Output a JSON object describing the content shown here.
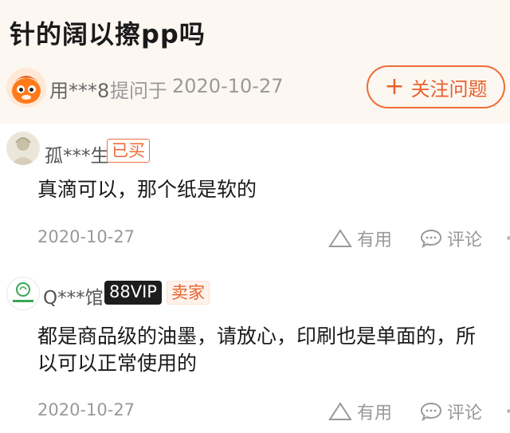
{
  "question": {
    "title": "针的阔以擦pp吗",
    "asker": "用***8",
    "ask_label": "提问于",
    "ask_date": "2020-10-27",
    "follow_label": "关注问题"
  },
  "answers": [
    {
      "user": "孤***生",
      "badges": [
        "已买"
      ],
      "lines": [
        "真滴可以，那个纸是软的"
      ],
      "date": "2020-10-27",
      "useful_label": "有用",
      "comment_label": "评论"
    },
    {
      "user": "Q***馆",
      "badges": [
        "88VIP",
        "卖家"
      ],
      "lines": [
        "都是商品级的油墨，请放心，印刷也是单面的，所",
        "以可以正常使用的"
      ],
      "date": "2020-10-27",
      "useful_label": "有用",
      "comment_label": "评论"
    }
  ],
  "colors": {
    "accent": "#e8612b",
    "header_bg": "#fdf7f2",
    "muted": "#999999"
  },
  "icons": [
    "mascot-avatar-icon",
    "plus-icon",
    "triangle-useful-icon",
    "comment-bubble-icon"
  ]
}
